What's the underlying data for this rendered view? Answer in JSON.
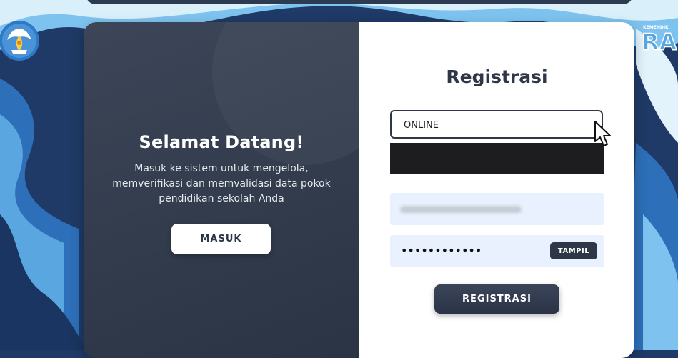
{
  "welcome": {
    "title": "Selamat Datang!",
    "line1": "Masuk ke sistem untuk mengelola,",
    "line2": "memverifikasi dan memvalidasi data pokok",
    "line3": "pendidikan sekolah Anda",
    "login_button": "MASUK"
  },
  "registration": {
    "title": "Registrasi",
    "select_value": "ONLINE",
    "password_mask": "••••••••••••",
    "show_button": "TAMPIL",
    "submit_button": "REGISTRASI"
  },
  "branding": {
    "right_logo_text": "RAN"
  },
  "colors": {
    "dark_panel": "#323c4d",
    "button_dark": "#2e3748",
    "input_bg": "#e9f1fe",
    "background_blue": "#1f3a66"
  }
}
